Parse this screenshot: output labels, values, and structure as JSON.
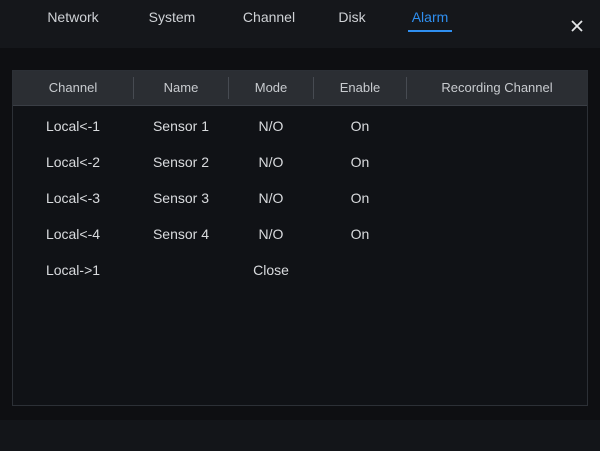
{
  "tabs": [
    {
      "label": "Network"
    },
    {
      "label": "System"
    },
    {
      "label": "Channel"
    },
    {
      "label": "Disk"
    },
    {
      "label": "Alarm",
      "active": true
    }
  ],
  "close_label": "×",
  "table": {
    "headers": [
      "Channel",
      "Name",
      "Mode",
      "Enable",
      "Recording Channel"
    ],
    "rows": [
      {
        "channel": "Local<-1",
        "name": "Sensor 1",
        "mode": "N/O",
        "enable": "On",
        "recording": ""
      },
      {
        "channel": "Local<-2",
        "name": "Sensor 2",
        "mode": "N/O",
        "enable": "On",
        "recording": ""
      },
      {
        "channel": "Local<-3",
        "name": "Sensor 3",
        "mode": "N/O",
        "enable": "On",
        "recording": ""
      },
      {
        "channel": "Local<-4",
        "name": "Sensor 4",
        "mode": "N/O",
        "enable": "On",
        "recording": ""
      },
      {
        "channel": "Local->1",
        "name": "",
        "mode": "Close",
        "enable": "",
        "recording": ""
      }
    ]
  },
  "colors": {
    "accent": "#2f8ff0",
    "background": "#0e0f12",
    "header_bg": "#2b2e33"
  }
}
